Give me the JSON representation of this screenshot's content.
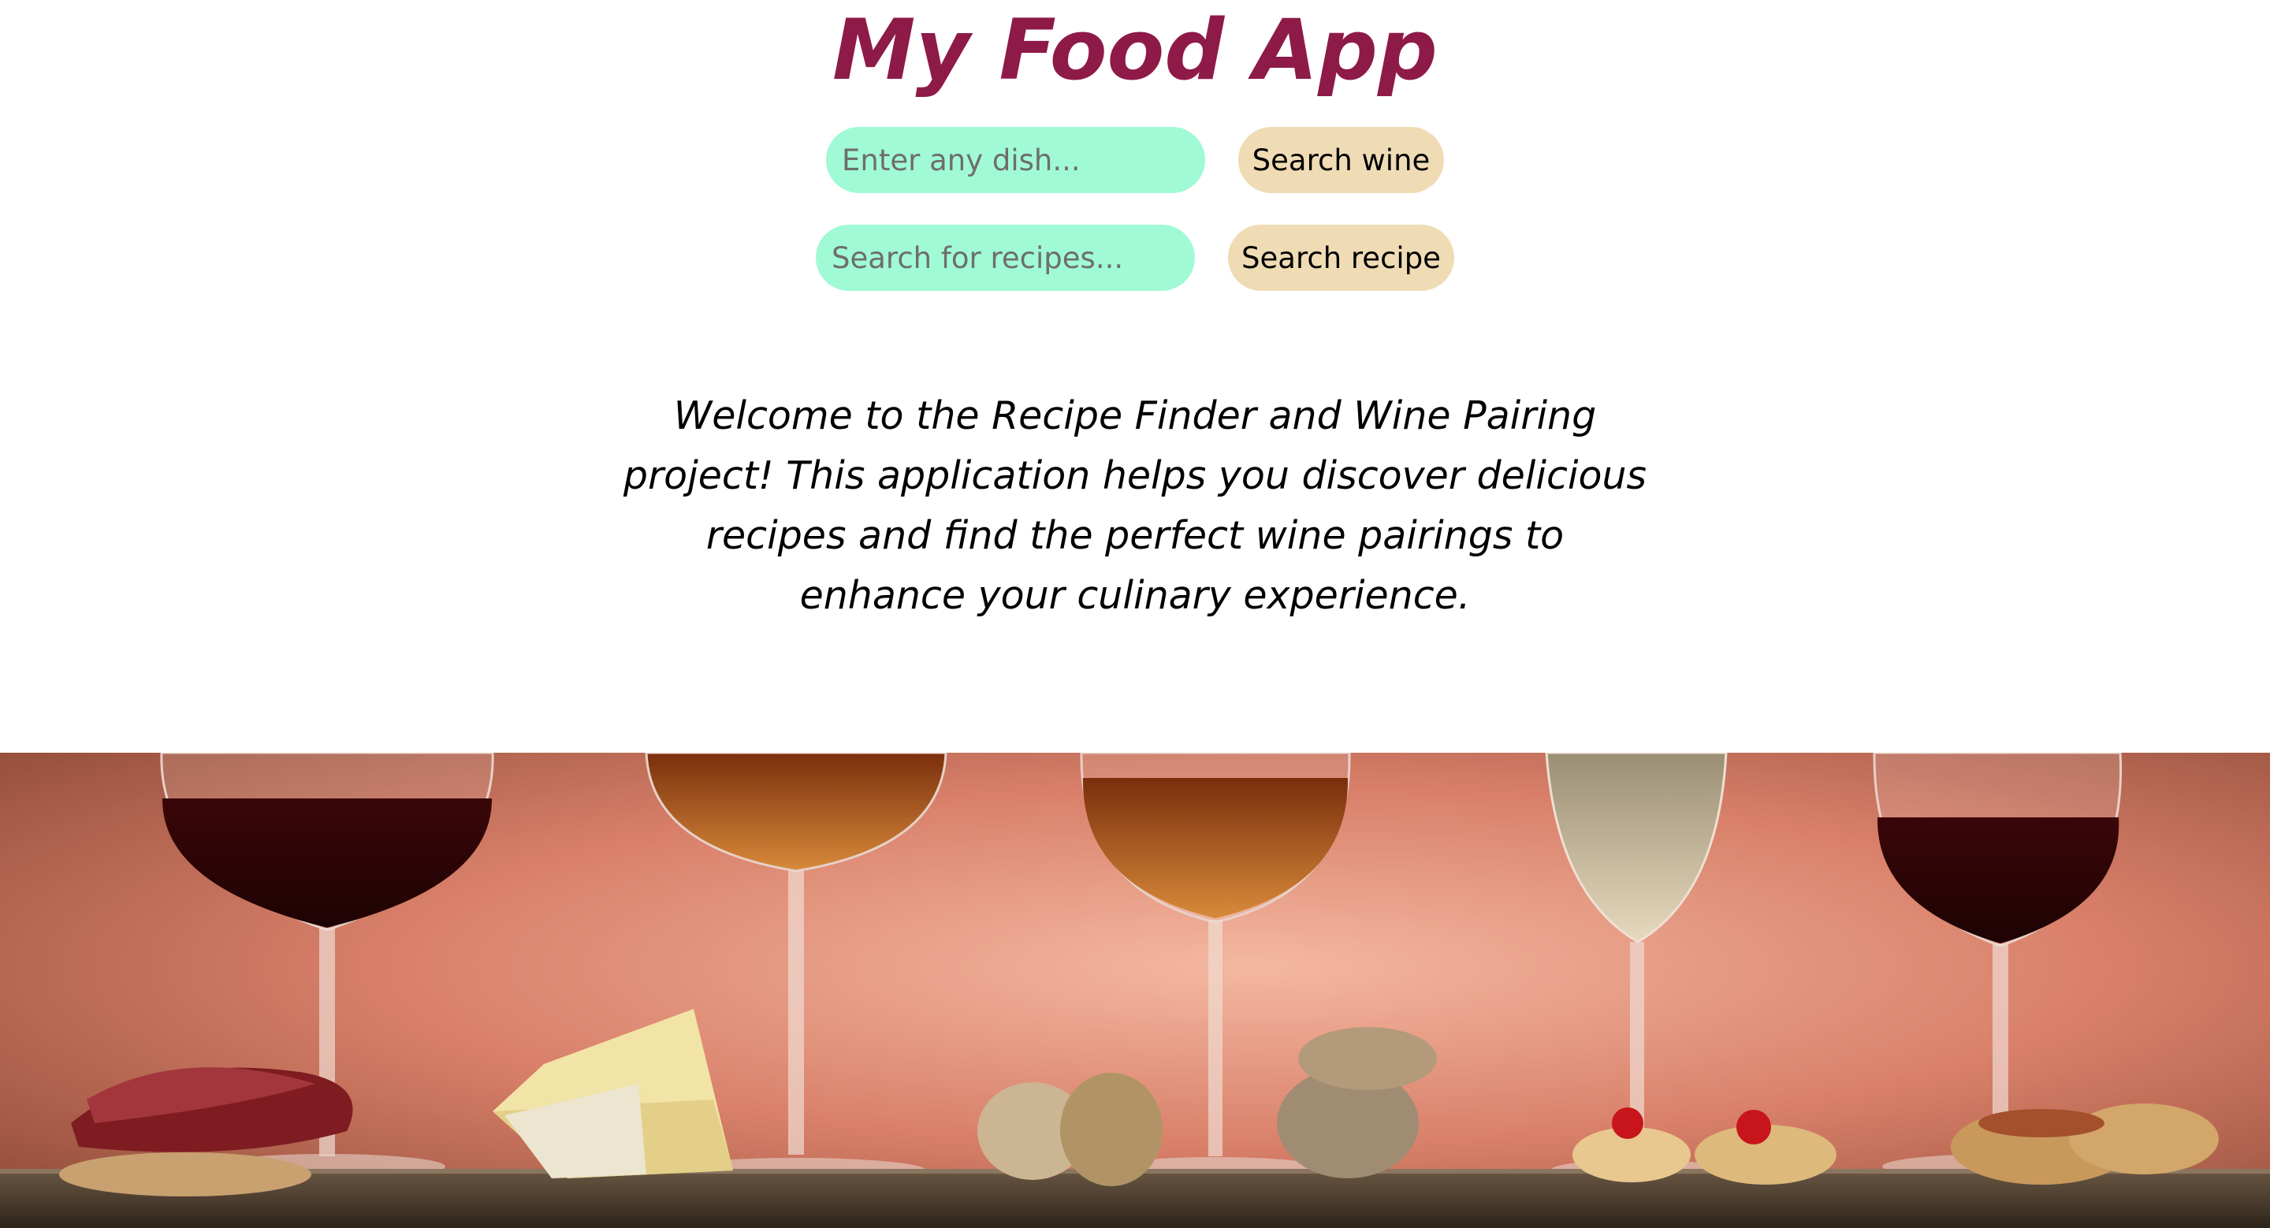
{
  "header": {
    "title": "My Food App"
  },
  "wine_search": {
    "placeholder": "Enter any dish...",
    "button_label": "Search wine"
  },
  "recipe_search": {
    "placeholder": "Search for recipes...",
    "button_label": "Search recipe"
  },
  "intro": {
    "text": "Welcome to the Recipe Finder and Wine Pairing project! This application helps you discover delicious recipes and find the perfect wine pairings to enhance your culinary experience."
  },
  "banner": {
    "image": "wine-glasses-and-appetizers-photo"
  },
  "colors": {
    "title": "#8e1a48",
    "input_bg": "#a0fad6",
    "button_bg": "#efdcb5"
  }
}
